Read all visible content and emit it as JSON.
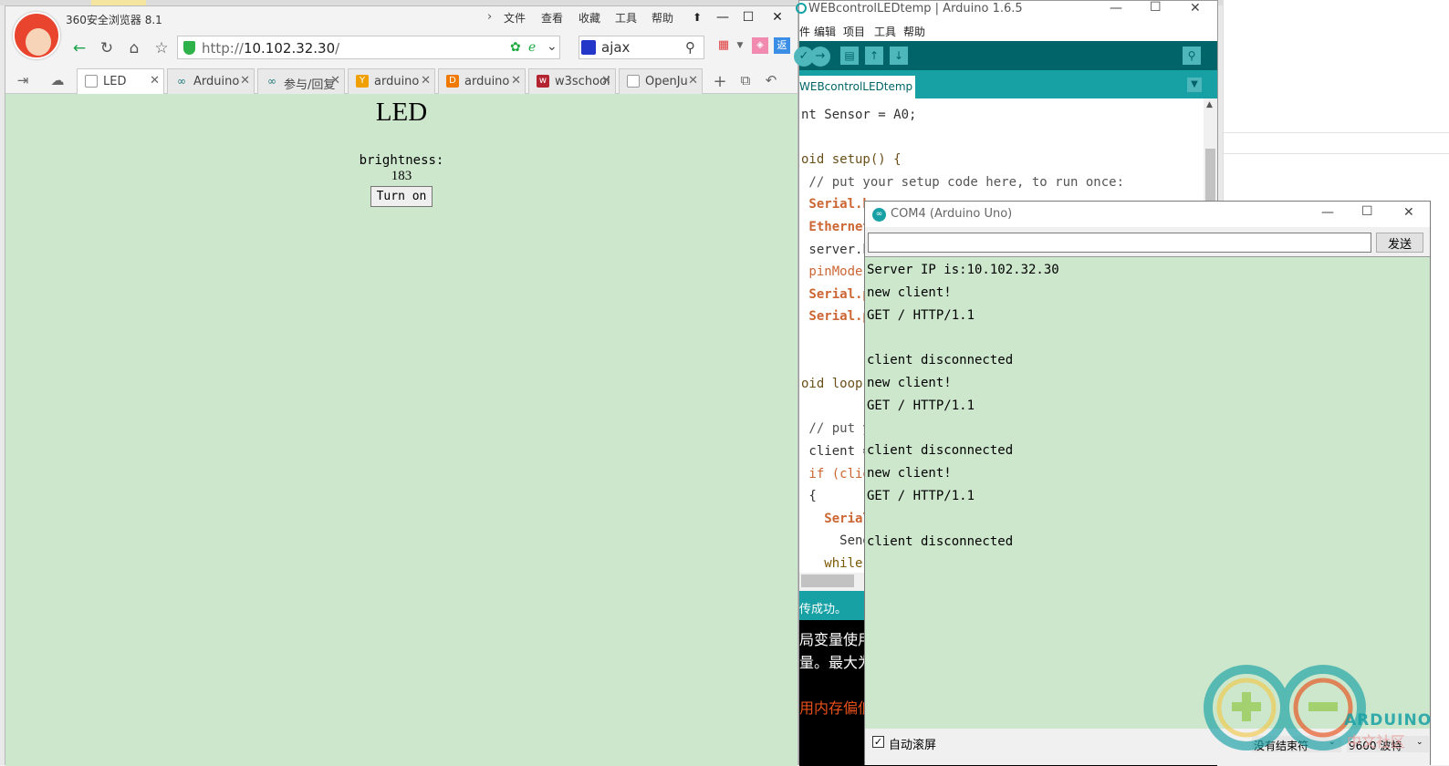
{
  "browser": {
    "title": "360安全浏览器 8.1",
    "menu": [
      "文件",
      "查看",
      "收藏",
      "工具",
      "帮助"
    ],
    "window_controls": [
      "—",
      "☐",
      "✕"
    ],
    "address": {
      "scheme": "http://",
      "host": "10.102.32.30",
      "path": "/"
    },
    "search_text": "ajax",
    "tabs": [
      {
        "label": "LED",
        "active": true
      },
      {
        "label": "Arduino",
        "active": false
      },
      {
        "label": "参与/回复",
        "active": false
      },
      {
        "label": "arduino",
        "active": false
      },
      {
        "label": "arduino",
        "active": false
      },
      {
        "label": "w3school",
        "active": false
      },
      {
        "label": "OpenJu",
        "active": false
      }
    ],
    "page": {
      "heading": "LED",
      "brightness_label": "brightness:",
      "brightness_value": "183",
      "button_label": "Turn on"
    }
  },
  "ide": {
    "title": "WEBcontrolLEDtemp | Arduino 1.6.5",
    "menu": [
      "件",
      "编辑",
      "项目",
      "工具",
      "帮助"
    ],
    "tab_label": "WEBcontrolLEDtemp",
    "code_lines": [
      {
        "t": "nt Sensor = A0;",
        "c": "normal"
      },
      {
        "t": "",
        "c": "normal"
      },
      {
        "t": "oid setup() {",
        "c": "setup"
      },
      {
        "t": " // put your setup code here, to run once:",
        "c": "comment"
      },
      {
        "t": " Serial.b",
        "c": "kw"
      },
      {
        "t": " Ethernet",
        "c": "kw"
      },
      {
        "t": " server.be",
        "c": "server"
      },
      {
        "t": " pinMode(L",
        "c": "pin"
      },
      {
        "t": " Serial.p",
        "c": "kw"
      },
      {
        "t": " Serial.p",
        "c": "kw"
      },
      {
        "t": "",
        "c": "normal"
      },
      {
        "t": "",
        "c": "normal"
      },
      {
        "t": "oid loop()",
        "c": "setup"
      },
      {
        "t": "",
        "c": "normal"
      },
      {
        "t": " // put yo",
        "c": "comment"
      },
      {
        "t": " client =",
        "c": "normal"
      },
      {
        "t": " if (clie",
        "c": "if"
      },
      {
        "t": " {",
        "c": "normal"
      },
      {
        "t": "   Serial",
        "c": "kw"
      },
      {
        "t": "     SendH",
        "c": "normal"
      },
      {
        "t": "   while (",
        "c": "while"
      }
    ],
    "status": "传成功。",
    "console": [
      {
        "t": "局变量使用",
        "c": "#ffffff"
      },
      {
        "t": "量。最大为",
        "c": "#ffffff"
      },
      {
        "t": "",
        "c": "#ffffff"
      },
      {
        "t": "用内存偏低",
        "c": "#e8501a"
      }
    ]
  },
  "serial": {
    "title": "COM4 (Arduino Uno)",
    "input_value": "",
    "send_label": "发送",
    "lines": [
      "Server IP is:10.102.32.30",
      "new client!",
      "GET / HTTP/1.1",
      "",
      "client disconnected",
      "new client!",
      "GET / HTTP/1.1",
      "",
      "client disconnected",
      "new client!",
      "GET / HTTP/1.1",
      "",
      "client disconnected"
    ],
    "autoscroll_label": "自动滚屏",
    "autoscroll_checked": true,
    "line_ending": "没有结束符",
    "baud": "9600 波特"
  },
  "watermark": {
    "brand": "ARDUINO",
    "sub": "中文社区"
  },
  "colors": {
    "page_bg": "#cde7cd",
    "ide_teal_dark": "#006468",
    "ide_teal": "#17a1a5",
    "keyword": "#cc6633"
  }
}
